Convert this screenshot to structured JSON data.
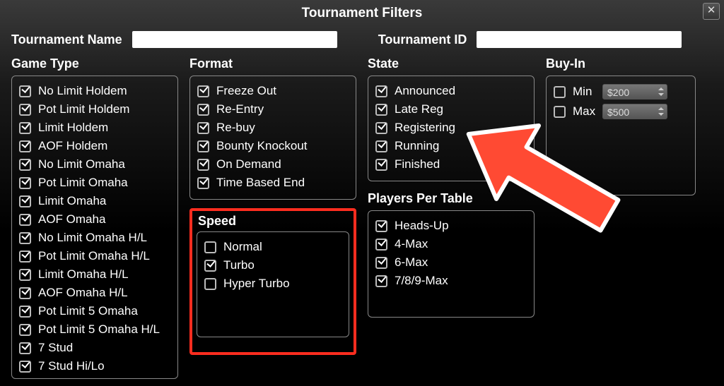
{
  "title": "Tournament Filters",
  "top": {
    "name_label": "Tournament Name",
    "name_value": "",
    "id_label": "Tournament ID",
    "id_value": ""
  },
  "gameType": {
    "header": "Game Type",
    "items": [
      {
        "label": "No Limit Holdem",
        "checked": true
      },
      {
        "label": "Pot Limit Holdem",
        "checked": true
      },
      {
        "label": "Limit Holdem",
        "checked": true
      },
      {
        "label": "AOF Holdem",
        "checked": true
      },
      {
        "label": "No Limit Omaha",
        "checked": true
      },
      {
        "label": "Pot Limit Omaha",
        "checked": true
      },
      {
        "label": "Limit Omaha",
        "checked": true
      },
      {
        "label": "AOF Omaha",
        "checked": true
      },
      {
        "label": "No Limit Omaha H/L",
        "checked": true
      },
      {
        "label": "Pot Limit Omaha H/L",
        "checked": true
      },
      {
        "label": "Limit Omaha H/L",
        "checked": true
      },
      {
        "label": "AOF Omaha H/L",
        "checked": true
      },
      {
        "label": "Pot Limit 5 Omaha",
        "checked": true
      },
      {
        "label": "Pot Limit 5 Omaha H/L",
        "checked": true
      },
      {
        "label": "7 Stud",
        "checked": true
      },
      {
        "label": "7 Stud Hi/Lo",
        "checked": true
      }
    ]
  },
  "format": {
    "header": "Format",
    "items": [
      {
        "label": "Freeze Out",
        "checked": true
      },
      {
        "label": "Re-Entry",
        "checked": true
      },
      {
        "label": "Re-buy",
        "checked": true
      },
      {
        "label": "Bounty Knockout",
        "checked": true
      },
      {
        "label": "On Demand",
        "checked": true
      },
      {
        "label": "Time Based End",
        "checked": true
      }
    ]
  },
  "speed": {
    "header": "Speed",
    "items": [
      {
        "label": "Normal",
        "checked": false
      },
      {
        "label": "Turbo",
        "checked": true
      },
      {
        "label": "Hyper Turbo",
        "checked": false
      }
    ]
  },
  "state": {
    "header": "State",
    "items": [
      {
        "label": "Announced",
        "checked": true
      },
      {
        "label": "Late Reg",
        "checked": true
      },
      {
        "label": "Registering",
        "checked": true
      },
      {
        "label": "Running",
        "checked": true
      },
      {
        "label": "Finished",
        "checked": true
      }
    ]
  },
  "ppt": {
    "header": "Players Per Table",
    "items": [
      {
        "label": "Heads-Up",
        "checked": true
      },
      {
        "label": "4-Max",
        "checked": true
      },
      {
        "label": "6-Max",
        "checked": true
      },
      {
        "label": "7/8/9-Max",
        "checked": true
      }
    ]
  },
  "buyIn": {
    "header": "Buy-In",
    "min_label": "Min",
    "min_checked": false,
    "min_value": "$200",
    "max_label": "Max",
    "max_checked": false,
    "max_value": "$500"
  }
}
